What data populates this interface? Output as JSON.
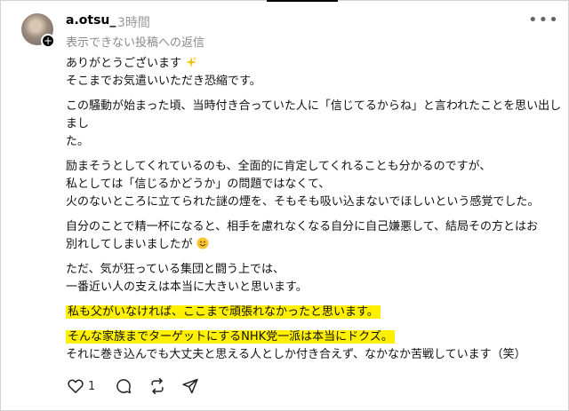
{
  "post": {
    "username": "a.otsu_",
    "time": "3時間",
    "reply_note": "表示できない投稿への返信",
    "more_icon": "more-dots-icon",
    "lines": {
      "p1l1": "ありがとうございます",
      "p1l2": "そこまでお気遣いいただき恐縮です。",
      "p2l1": "この騒動が始まった頃、当時付き合っていた人に「信じてるからね」と言われたことを思い出しまし",
      "p2l2": "た。",
      "p3l1": "励まそうとしてくれているのも、全面的に肯定してくれることも分かるのですが、",
      "p3l2": "私としては「信じるかどうか」の問題ではなくて、",
      "p3l3": "火のないところに立てられた謎の煙を、そもそも吸い込まないでほしいという感覚でした。",
      "p4l1": "自分のことで精一杯になると、相手を慮れなくなる自分に自己嫌悪して、結局その方とはお",
      "p4l2": "別れしてしまいましたが",
      "p5l1": "ただ、気が狂っている集団と闘う上では、",
      "p5l2": "一番近い人の支えは本当に大きいと思います。",
      "p6l1": "私も父がいなければ、ここまで頑張れなかったと思います。",
      "p7l1": "そんな家族までターゲットにするNHK党一派は本当にドクズ。",
      "p7l2": "それに巻き込んでも大丈夫と思える人としか付き合えず、なかなか苦戦しています（笑）"
    },
    "like_count": "1"
  }
}
